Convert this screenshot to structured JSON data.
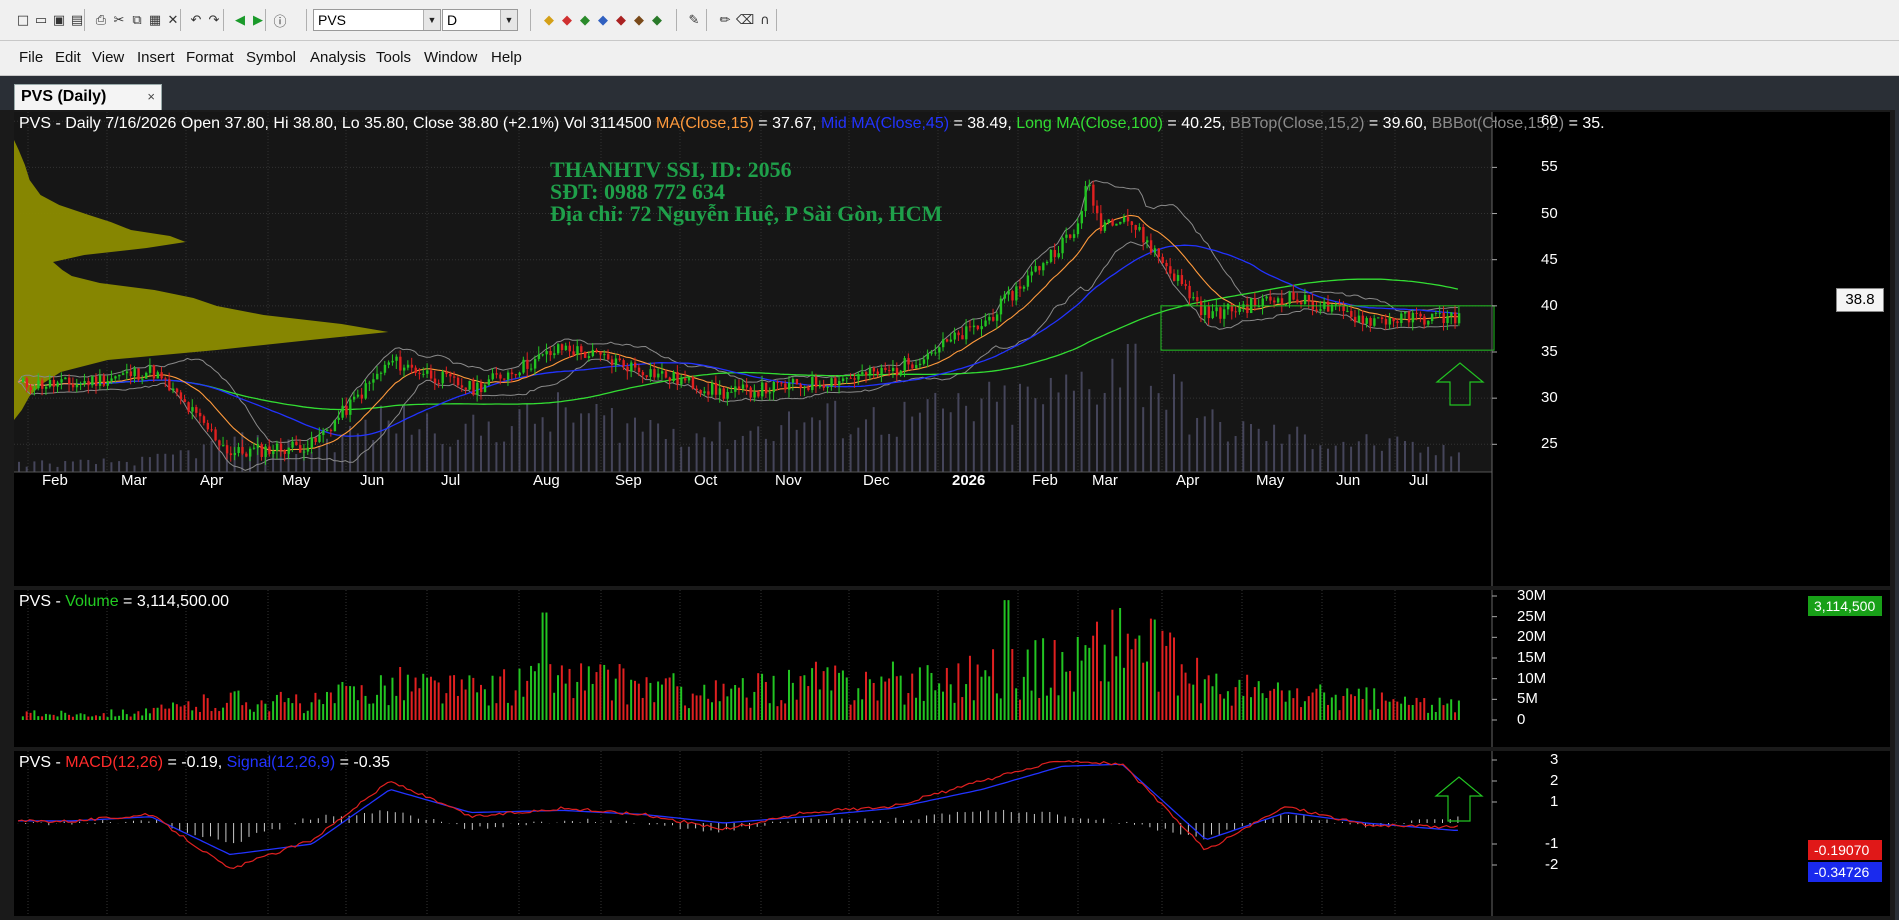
{
  "app": {
    "symbol_combo": "PVS",
    "interval_combo": "D",
    "menu": [
      "File",
      "Edit",
      "View",
      "Insert",
      "Format",
      "Symbol",
      "Analysis",
      "Tools",
      "Window",
      "Help"
    ],
    "tab": {
      "label": "PVS (Daily)",
      "close": "×"
    }
  },
  "toolbar_icons": [
    "new-icon",
    "open-icon",
    "save-icon",
    "save-all-icon",
    "print-icon",
    "cut-icon",
    "copy-icon",
    "paste-icon",
    "delete-icon",
    "undo-icon",
    "redo-icon",
    "back-icon",
    "forward-icon",
    "info-icon",
    "drawing-tools-icon",
    "pen-icon",
    "eraser-icon",
    "magnet-icon"
  ],
  "price_pane": {
    "title": [
      {
        "text": "PVS - Daily 7/16/2026 Open 37.80, Hi 38.80, Lo 35.80, Close 38.80 (+2.1%) Vol 3114500 ",
        "color": "#ffffff"
      },
      {
        "text": "MA(Close,15)",
        "color": "#ff9a3c"
      },
      {
        "text": " = 37.67, ",
        "color": "#ffffff"
      },
      {
        "text": "Mid MA(Close,45)",
        "color": "#2233ff"
      },
      {
        "text": " = 38.49, ",
        "color": "#ffffff"
      },
      {
        "text": "Long MA(Close,100)",
        "color": "#33dd33"
      },
      {
        "text": " = 40.25, ",
        "color": "#ffffff"
      },
      {
        "text": "BBTop(Close,15,2)",
        "color": "#8a8a8a"
      },
      {
        "text": " = 39.60, ",
        "color": "#ffffff"
      },
      {
        "text": "BBBot(Close,15,2)",
        "color": "#8a8a8a"
      },
      {
        "text": " = 35.",
        "color": "#ffffff"
      }
    ],
    "watermark": [
      "THANHTV SSI, ID: 2056",
      "SĐT: 0988 772 634",
      "Địa chỉ: 72 Nguyễn Huệ, P Sài Gòn, HCM"
    ],
    "y_ticks": [
      "60",
      "55",
      "50",
      "45",
      "40",
      "35",
      "30",
      "25"
    ],
    "last_price": "38.8",
    "months": [
      {
        "label": "Feb"
      },
      {
        "label": "Mar"
      },
      {
        "label": "Apr"
      },
      {
        "label": "May"
      },
      {
        "label": "Jun"
      },
      {
        "label": "Jul"
      },
      {
        "label": "Aug"
      },
      {
        "label": "Sep"
      },
      {
        "label": "Oct"
      },
      {
        "label": "Nov"
      },
      {
        "label": "Dec"
      },
      {
        "label": "2026",
        "bold": true
      },
      {
        "label": "Feb"
      },
      {
        "label": "Mar"
      },
      {
        "label": "Apr"
      },
      {
        "label": "May"
      },
      {
        "label": "Jun"
      },
      {
        "label": "Jul"
      }
    ]
  },
  "volume_pane": {
    "title": [
      {
        "text": "PVS - ",
        "color": "#ffffff"
      },
      {
        "text": "Volume",
        "color": "#22cc22"
      },
      {
        "text": " = 3,114,500.00",
        "color": "#ffffff"
      }
    ],
    "y_ticks": [
      "30M",
      "25M",
      "20M",
      "15M",
      "10M",
      "5M",
      "0"
    ],
    "last_value": "3,114,500"
  },
  "macd_pane": {
    "title": [
      {
        "text": "PVS - ",
        "color": "#ffffff"
      },
      {
        "text": "MACD(12,26)",
        "color": "#ff2a2a"
      },
      {
        "text": " = -0.19, ",
        "color": "#ffffff"
      },
      {
        "text": "Signal(12,26,9)",
        "color": "#2233ff"
      },
      {
        "text": " = -0.35",
        "color": "#ffffff"
      }
    ],
    "y_ticks": [
      "3",
      "2",
      "1",
      "-1",
      "-2"
    ],
    "macd_flag": "-0.19070",
    "signal_flag": "-0.34726"
  },
  "colors": {
    "up": "#22c422",
    "down": "#e02020",
    "ma15": "#ff9a3c",
    "ma45": "#2233ff",
    "ma100": "#33dd33",
    "bb": "#8a8a8a",
    "profile": "#8c8c00"
  },
  "chart_data": {
    "type": "line",
    "x": [
      "Feb",
      "Mar",
      "Apr",
      "May",
      "Jun",
      "Jul",
      "Aug",
      "Sep",
      "Oct",
      "Nov",
      "Dec",
      "2026",
      "Feb",
      "Mar",
      "Apr",
      "May",
      "Jun",
      "Jul"
    ],
    "series": [
      {
        "name": "Close",
        "values": [
          31.5,
          33.0,
          24.0,
          25.0,
          34.0,
          31.0,
          35.5,
          33.0,
          30.5,
          31.5,
          33.0,
          38.0,
          47.0,
          50.0,
          39.0,
          41.0,
          38.5,
          38.8
        ]
      },
      {
        "name": "Volume",
        "values": [
          1.5,
          2.0,
          5.0,
          4.0,
          9.0,
          7.0,
          10.0,
          8.0,
          6.0,
          9.0,
          9.0,
          11.0,
          13.0,
          20.0,
          8.0,
          6.0,
          5.0,
          3.1
        ]
      },
      {
        "name": "MACD(12,26)",
        "values": [
          0.1,
          0.4,
          -2.2,
          -0.8,
          2.0,
          0.3,
          0.7,
          0.4,
          -0.3,
          0.5,
          0.8,
          2.0,
          3.0,
          2.8,
          -1.3,
          0.8,
          -0.1,
          -0.19
        ]
      },
      {
        "name": "Signal(12,26,9)",
        "values": [
          0.1,
          0.3,
          -1.5,
          -1.0,
          1.6,
          0.5,
          0.6,
          0.4,
          0.0,
          0.3,
          0.7,
          1.6,
          2.7,
          2.8,
          -0.8,
          0.5,
          0.0,
          -0.35
        ]
      }
    ],
    "ylim": [
      22,
      61
    ]
  }
}
